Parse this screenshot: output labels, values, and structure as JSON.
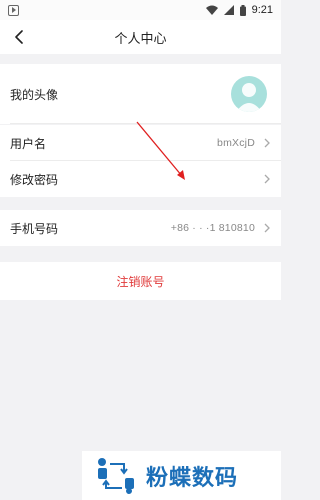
{
  "status_bar": {
    "time": "9:21"
  },
  "header": {
    "title": "个人中心",
    "back_icon": "back-arrow-icon"
  },
  "profile": {
    "avatar_label": "我的头像",
    "username_label": "用户名",
    "username_value": "bmXcjD",
    "change_password_label": "修改密码"
  },
  "phone": {
    "label": "手机号码",
    "value": "+86 · · ·1 810810"
  },
  "account": {
    "cancel_label": "注销账号"
  },
  "watermark": {
    "text": "粉蝶数码"
  },
  "colors": {
    "danger": "#e03a3a",
    "brand": "#1c6fb8",
    "avatar_bg": "#a8e0dc"
  }
}
